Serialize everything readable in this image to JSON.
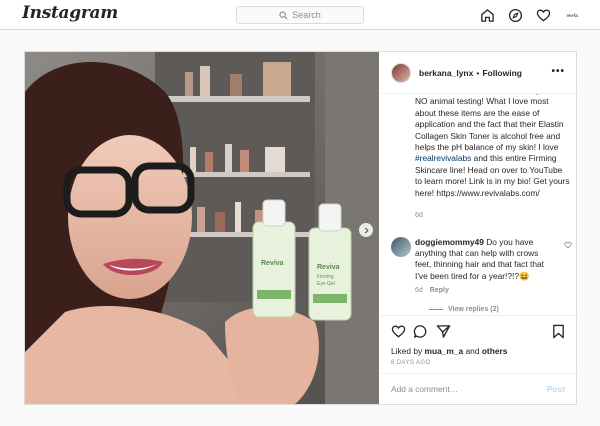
{
  "topbar": {
    "logo": "Instagram",
    "search_placeholder": "Search",
    "icons": [
      "home-icon",
      "explore-compass-icon",
      "activity-heart-icon",
      "profile-avatar"
    ],
    "avatar_text": "rev-fa"
  },
  "post": {
    "author": {
      "username": "berkana_lynx",
      "separator": "•",
      "follow_label": "Following",
      "more_label": "•••"
    },
    "photo": {
      "description_icons": [
        "next-arrow-icon"
      ],
      "product_label": "Reviva",
      "product_subtext": [
        "Firming",
        "Eye Gel"
      ]
    },
    "caption": {
      "text_before_tag": "the USA? Look no further. Cruelty free, NO animal testing! What I love most about these items are the ease of application and the fact that their Elastin Collagen Skin Toner is alcohol free and helps the pH balance of my skin! I love ",
      "hashtag": "#realrevivalabs",
      "text_after_tag": " and this entire Firming Skincare line! Head on over to YouTube to learn more! Link is in my bio! Get yours here! https://www.revivalabs.com/",
      "age": "6d"
    },
    "comments": [
      {
        "username": "doggiemommy49",
        "text": "Do you have anything that can help with crows feet, thinning hair and that fact that I've been tired for a year!?!?😆",
        "age": "6d",
        "reply_label": "Reply",
        "view_replies": "View replies (2)"
      }
    ],
    "liked_by": {
      "prefix": "Liked by ",
      "user": "mua_m_a",
      "middle": " and ",
      "others": "others"
    },
    "timestamp": "6 DAYS AGO",
    "add_comment_placeholder": "Add a comment…",
    "post_button": "Post"
  },
  "colors": {
    "link": "#00376b",
    "post_button_disabled": "#b2dffc",
    "border": "#dbdbdb",
    "background": "#fafafa"
  }
}
